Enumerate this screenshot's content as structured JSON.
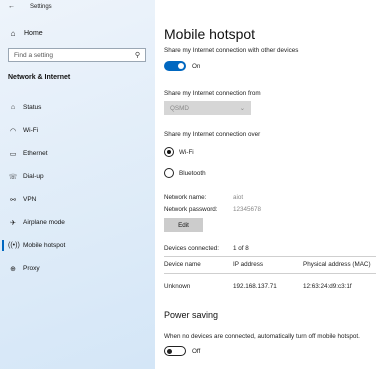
{
  "window": {
    "title": "Settings"
  },
  "sidebar": {
    "home": "Home",
    "search_placeholder": "Find a setting",
    "section": "Network & Internet",
    "items": [
      {
        "label": "Status",
        "icon": "home-globe-icon"
      },
      {
        "label": "Wi-Fi",
        "icon": "wifi-icon"
      },
      {
        "label": "Ethernet",
        "icon": "ethernet-icon"
      },
      {
        "label": "Dial-up",
        "icon": "dialup-icon"
      },
      {
        "label": "VPN",
        "icon": "vpn-icon"
      },
      {
        "label": "Airplane mode",
        "icon": "airplane-icon"
      },
      {
        "label": "Mobile hotspot",
        "icon": "hotspot-icon"
      },
      {
        "label": "Proxy",
        "icon": "globe-icon"
      }
    ]
  },
  "main": {
    "title": "Mobile hotspot",
    "share_label": "Share my Internet connection with other devices",
    "share_state": "On",
    "from_label": "Share my Internet connection from",
    "from_value": "QSMD",
    "over_label": "Share my Internet connection over",
    "over_options": [
      "Wi-Fi",
      "Bluetooth"
    ],
    "network_name_label": "Network name:",
    "network_name_value": "aiot",
    "network_password_label": "Network password:",
    "network_password_value": "12345678",
    "edit_button": "Edit",
    "devices_label": "Devices connected:",
    "devices_value": "1 of 8",
    "table": {
      "headers": [
        "Device name",
        "IP address",
        "Physical address (MAC)"
      ],
      "rows": [
        [
          "Unknown",
          "192.168.137.71",
          "12:63:24:d9:c3:1f"
        ]
      ]
    },
    "power_title": "Power saving",
    "power_desc": "When no devices are connected, automatically turn off mobile hotspot.",
    "power_state": "Off"
  },
  "colors": {
    "accent": "#0067c0"
  }
}
